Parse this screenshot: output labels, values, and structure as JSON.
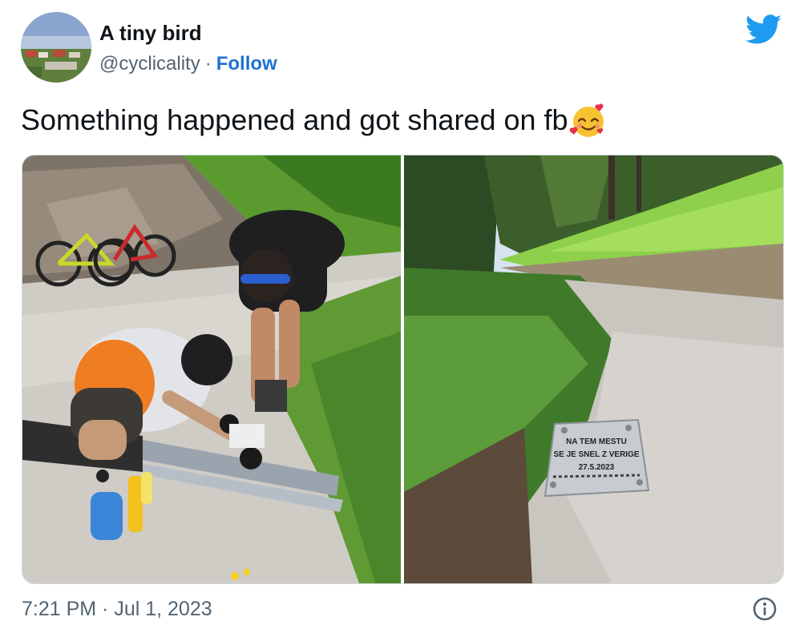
{
  "author": {
    "display_name": "A tiny bird",
    "handle": "@cyclicality",
    "separator": "·",
    "follow_label": "Follow"
  },
  "tweet": {
    "text": "Something happened and got shared on fb",
    "emoji": "smiling-face-with-hearts",
    "timestamp": "7:21 PM · Jul 1, 2023"
  },
  "media": {
    "plaque": {
      "line1": "NA TEM MESTU",
      "line2": "SE JE SNEL Z VERIGE",
      "line3": "27.5.2023"
    }
  },
  "icons": {
    "logo": "twitter-bird-icon",
    "info": "info-icon"
  },
  "colors": {
    "accent": "#1d9bf0",
    "follow": "#1d72d4",
    "muted": "#536471"
  }
}
